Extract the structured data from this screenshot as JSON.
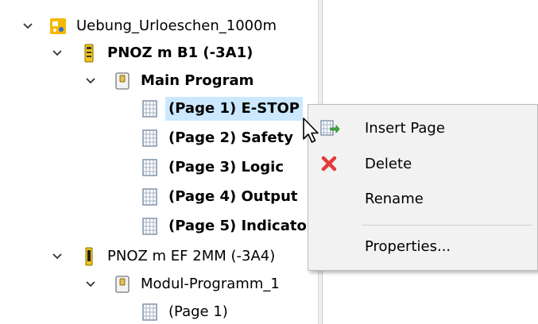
{
  "tree": {
    "items": [
      {
        "label": "Uebung_Urloeschen_1000m",
        "bold": false
      },
      {
        "label": "PNOZ m B1 (-3A1)",
        "bold": true
      },
      {
        "label": "Main Program",
        "bold": true
      },
      {
        "label": "(Page 1) E-STOP",
        "bold": true,
        "selected": true
      },
      {
        "label": "(Page 2) Safety",
        "bold": true
      },
      {
        "label": "(Page 3) Logic",
        "bold": true
      },
      {
        "label": "(Page 4) Output",
        "bold": true
      },
      {
        "label": "(Page 5) Indicato",
        "bold": true
      },
      {
        "label": "PNOZ m EF 2MM (-3A4)",
        "bold": false
      },
      {
        "label": "Modul-Programm_1",
        "bold": false
      },
      {
        "label": "(Page 1)",
        "bold": false
      }
    ]
  },
  "context_menu": {
    "items": [
      {
        "label": "Insert Page",
        "icon": "insert-page-icon"
      },
      {
        "label": "Delete",
        "icon": "delete-x-icon"
      },
      {
        "label": "Rename",
        "icon": ""
      },
      {
        "label": "Properties...",
        "icon": ""
      }
    ]
  },
  "colors": {
    "selection": "#cce8ff",
    "menu_background": "#f2f2f2",
    "delete_icon": "#e23b3b",
    "project_icon": "#f5b800"
  }
}
